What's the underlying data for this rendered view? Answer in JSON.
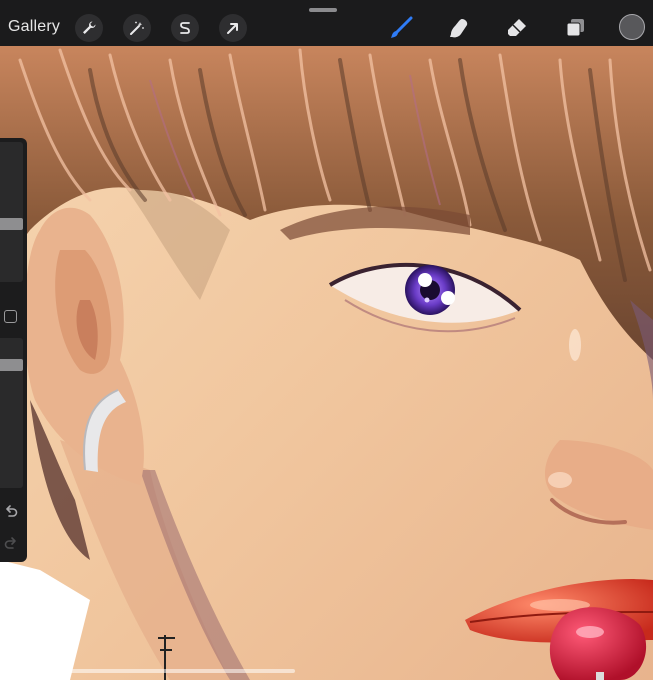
{
  "toolbar": {
    "gallery_label": "Gallery",
    "left_tools": [
      {
        "name": "actions",
        "icon": "wrench-icon"
      },
      {
        "name": "adjustments",
        "icon": "magic-wand-icon"
      },
      {
        "name": "selection",
        "icon": "selection-s-icon"
      },
      {
        "name": "transform",
        "icon": "arrow-cursor-icon"
      }
    ],
    "right_tools": [
      {
        "name": "brush",
        "icon": "brush-icon",
        "active": true
      },
      {
        "name": "smudge",
        "icon": "smudge-finger-icon",
        "active": false
      },
      {
        "name": "eraser",
        "icon": "eraser-icon",
        "active": false
      },
      {
        "name": "layers",
        "icon": "layers-icon",
        "active": false
      }
    ],
    "current_color": "#58585b",
    "accent_color": "#2f7cf6"
  },
  "sidebar": {
    "brush_size_level": 0.22,
    "opacity_level": 0.15,
    "icons": [
      "square-modify-icon",
      "undo-icon",
      "redo-icon"
    ]
  }
}
